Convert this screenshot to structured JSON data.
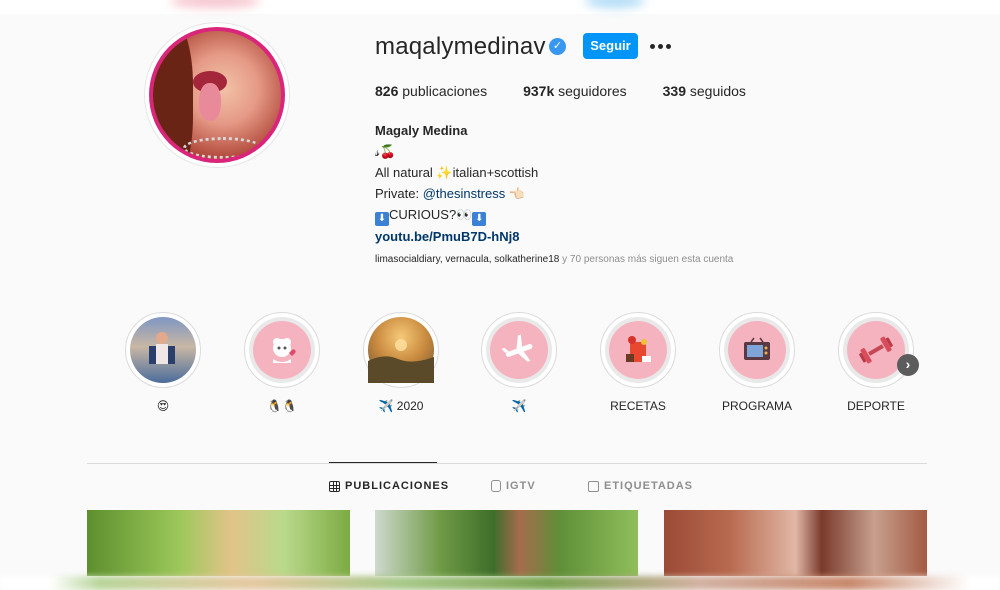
{
  "profile": {
    "username": "maqalymedinav",
    "follow_label": "Seguir",
    "stats": {
      "posts_count": "826",
      "posts_label": "publicaciones",
      "followers_count": "937k",
      "followers_label": "seguidores",
      "following_count": "339",
      "following_label": "seguidos"
    },
    "bio": {
      "name": "Magaly Medina",
      "line1": "𝓈🍒",
      "line2_a": "All natural ",
      "line2_emoji": "✨",
      "line2_b": "italian+scottish",
      "line3_a": "Private: ",
      "line3_mention": "@thesinstress",
      "line3_emoji": "👈🏻",
      "line4_arrow1": "⬇",
      "line4_text": "CURIOUS?👀",
      "line4_arrow2": "⬇",
      "link": "youtu.be/PmuB7D-hNj8"
    },
    "followed_by": "limasocialdiary, vernacula, solkatherine18",
    "followed_by_rest": " y 70 personas más siguen esta cuenta"
  },
  "highlights": [
    {
      "label": "😍",
      "icon": "people-photo-icon"
    },
    {
      "label": "🐧🐧",
      "icon": "dog-heart-icon"
    },
    {
      "label": "✈️ 2020",
      "icon": "sunset-photo-icon"
    },
    {
      "label": "✈️",
      "icon": "airplane-icon"
    },
    {
      "label": "RECETAS",
      "icon": "food-icon"
    },
    {
      "label": "PROGRAMA",
      "icon": "tv-icon"
    },
    {
      "label": "DEPORTE",
      "icon": "dumbbell-icon"
    }
  ],
  "tabs": [
    {
      "label": "PUBLICACIONES",
      "icon": "grid-icon",
      "active": true
    },
    {
      "label": "IGTV",
      "icon": "igtv-icon",
      "active": false
    },
    {
      "label": "ETIQUETADAS",
      "icon": "tagged-icon",
      "active": false
    }
  ],
  "colors": {
    "follow_button": "#0095f6",
    "verified": "#3897f0",
    "story_ring": "#d9267a",
    "highlight_pink": "#f5b3bf",
    "link": "#00376b"
  }
}
